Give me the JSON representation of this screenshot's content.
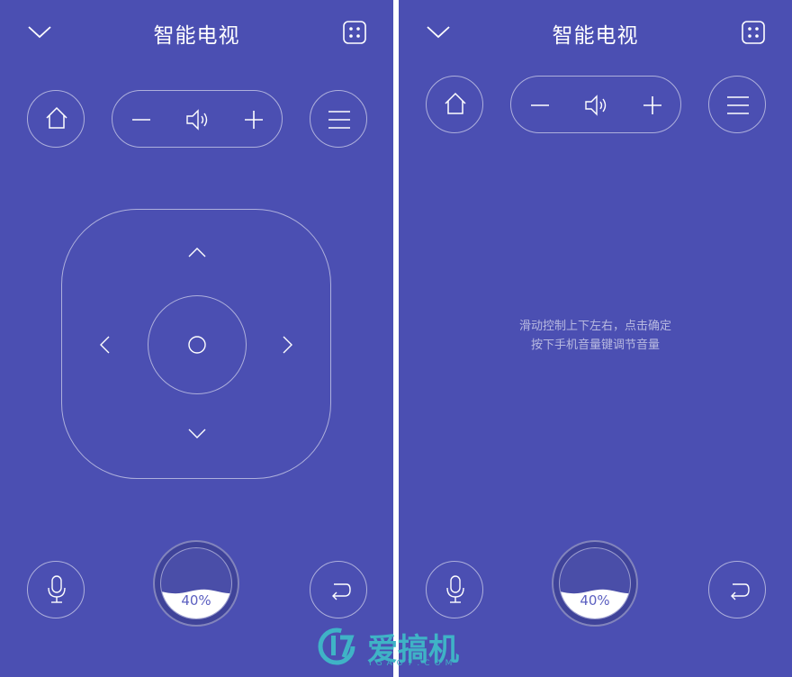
{
  "left_screen": {
    "title": "智能电视",
    "icons": {
      "collapse": "chevron-down-icon",
      "more": "dice-icon",
      "home": "home-icon",
      "volume_down": "minus-icon",
      "volume": "speaker-icon",
      "volume_up": "plus-icon",
      "menu": "menu-icon",
      "up": "chevron-up-icon",
      "down": "chevron-down-icon",
      "left": "chevron-left-icon",
      "right": "chevron-right-icon",
      "ok": "ok-circle-icon",
      "mic": "microphone-icon",
      "back": "back-arrow-icon"
    },
    "battery": {
      "label": "40%",
      "level": 0.4
    }
  },
  "right_screen": {
    "title": "智能电视",
    "hint_line1": "滑动控制上下左右，点击确定",
    "hint_line2": "按下手机音量键调节音量",
    "battery": {
      "label": "40%",
      "level": 0.4
    }
  },
  "watermark": {
    "text": "爱搞机",
    "sub": "IGAO7.COM"
  },
  "colors": {
    "background": "#4b4fb2",
    "accent": "#3fb3c6",
    "divider": "#ffffff"
  }
}
